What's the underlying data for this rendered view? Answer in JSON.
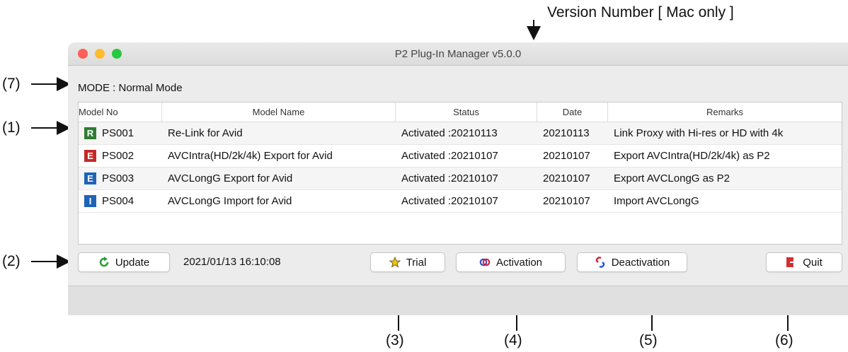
{
  "annotations": {
    "version_label": "Version Number [ Mac only ]",
    "callouts": [
      "(7)",
      "(1)",
      "(2)",
      "(3)",
      "(4)",
      "(5)",
      "(6)"
    ]
  },
  "window": {
    "title": "P2 Plug-In Manager v5.0.0",
    "mode": "MODE : Normal Mode"
  },
  "table": {
    "headers": [
      "Model No",
      "Model Name",
      "Status",
      "Date",
      "Remarks"
    ],
    "rows": [
      {
        "icon": "re-link-icon",
        "model_no": "PS001",
        "name": "Re-Link for Avid",
        "status": "Activated :20210113",
        "date": "20210113",
        "remarks": "Link Proxy with Hi-res or HD with 4k"
      },
      {
        "icon": "export-icon",
        "model_no": "PS002",
        "name": "AVCIntra(HD/2k/4k) Export for Avid",
        "status": "Activated :20210107",
        "date": "20210107",
        "remarks": "Export AVCIntra(HD/2k/4k) as P2"
      },
      {
        "icon": "export-longg-icon",
        "model_no": "PS003",
        "name": "AVCLongG Export for Avid",
        "status": "Activated :20210107",
        "date": "20210107",
        "remarks": "Export AVCLongG as P2"
      },
      {
        "icon": "import-icon",
        "model_no": "PS004",
        "name": "AVCLongG Import for Avid",
        "status": "Activated :20210107",
        "date": "20210107",
        "remarks": "Import AVCLongG"
      }
    ]
  },
  "toolbar": {
    "update_label": "Update",
    "timestamp": "2021/01/13 16:10:08",
    "trial_label": "Trial",
    "activation_label": "Activation",
    "deactivation_label": "Deactivation",
    "quit_label": "Quit"
  },
  "colors": {
    "close": "#fe5f57",
    "minimize": "#febc2e",
    "zoom": "#28c840"
  }
}
